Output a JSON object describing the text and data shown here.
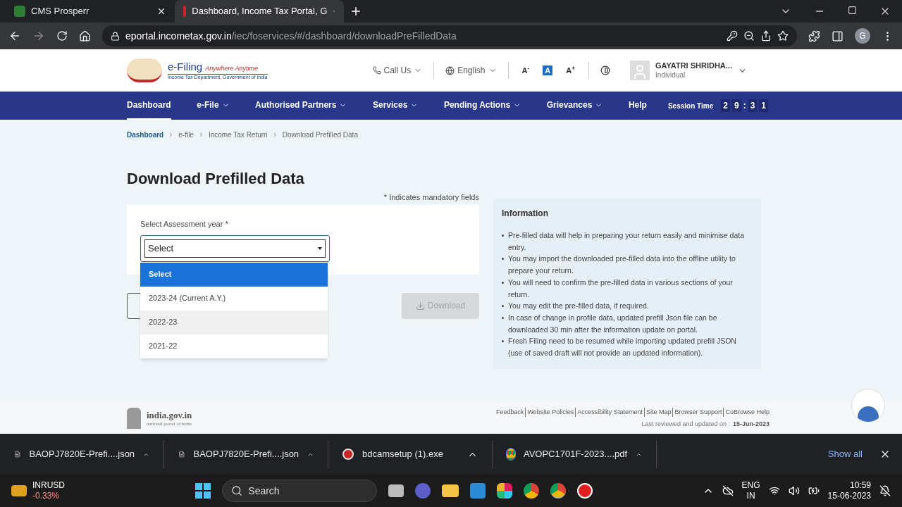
{
  "browser": {
    "tabs": [
      {
        "title": "CMS Prosperr",
        "selected": false
      },
      {
        "title": "Dashboard, Income Tax Portal, G",
        "selected": true
      }
    ],
    "url": {
      "host": "eportal.incometax.gov.in",
      "path": "/iec/foservices/#/dashboard/downloadPreFilledData"
    },
    "profile_initial": "G"
  },
  "header": {
    "logo": {
      "title": "e-Filing",
      "tagline": "Anywhere Anytime",
      "subtitle": "Income Tax Department, Government of India"
    },
    "call_us": "Call Us",
    "language": "English",
    "font_buttons": [
      {
        "label": "A$^{-}$",
        "selected": false
      },
      {
        "label": "A",
        "selected": true
      },
      {
        "label": "A$^{+}$",
        "selected": false
      }
    ],
    "user": {
      "name": "GAYATRI SHRIDHA...",
      "role": "Individual"
    }
  },
  "nav": {
    "items": [
      {
        "label": "Dashboard",
        "selected": true,
        "has_menu": false
      },
      {
        "label": "e-File",
        "selected": false,
        "has_menu": true
      },
      {
        "label": "Authorised Partners",
        "selected": false,
        "has_menu": true
      },
      {
        "label": "Services",
        "selected": false,
        "has_menu": true
      },
      {
        "label": "Pending Actions",
        "selected": false,
        "has_menu": true
      },
      {
        "label": "Grievances",
        "selected": false,
        "has_menu": true
      },
      {
        "label": "Help",
        "selected": false,
        "has_menu": false
      }
    ],
    "session": {
      "label": "Session Time",
      "digits": [
        "2",
        "9",
        ":",
        "3",
        "1"
      ]
    }
  },
  "breadcrumb": [
    {
      "label": "Dashboard",
      "link": true
    },
    {
      "label": "e-file",
      "link": false
    },
    {
      "label": "Income Tax Return",
      "link": false
    },
    {
      "label": "Download Prefilled Data",
      "link": false
    }
  ],
  "form": {
    "title": "Download Prefilled Data",
    "mandatory_note": "* Indicates mandatory fields",
    "field_label": "Select Assessment year *",
    "value": "Select",
    "options": [
      {
        "label": "Select",
        "selected": true,
        "hovered": false
      },
      {
        "label": "2023-24 (Current A.Y.)",
        "selected": false,
        "hovered": false
      },
      {
        "label": "2022-23",
        "selected": false,
        "hovered": true
      },
      {
        "label": "2021-22",
        "selected": false,
        "hovered": false
      }
    ],
    "download": {
      "label": "Download",
      "disabled": true
    }
  },
  "info": {
    "title": "Information",
    "items": [
      "Pre-filled data will help in preparing your return easily and minimise data entry.",
      "You may import the downloaded pre-filled data into the offline utility to prepare your return.",
      "You will need to confirm the pre-filled data in various sections of your return.",
      "You may edit the pre-filled data, if required.",
      "In case of change in profile data, updated prefill Json file can be downloaded 30 min after the information update on portal.",
      "Fresh Filing need to be resumed while importing updated prefill JSON (use of saved draft will not provide an updated information)."
    ]
  },
  "footer": {
    "site": {
      "name": "india.gov.in",
      "tagline": "national portal of india"
    },
    "links": [
      "Feedback",
      "Website Policies",
      "Accessibility Statement",
      "Site Map",
      "Browser Support",
      "CoBrowse Help"
    ],
    "updated_label": "Last reviewed and updated on :",
    "updated_date": "15-Jun-2023"
  },
  "downloads": {
    "items": [
      {
        "name": "BAOPJ7820E-Prefi....json",
        "kind": "file"
      },
      {
        "name": "BAOPJ7820E-Prefi....json",
        "kind": "file"
      },
      {
        "name": "bdcamsetup (1).exe",
        "kind": "app"
      },
      {
        "name": "AVOPC1701F-2023....pdf",
        "kind": "browser"
      }
    ],
    "show_all": "Show all"
  },
  "taskbar": {
    "ticker": {
      "symbol": "INRUSD",
      "change": "-0.33%"
    },
    "search": "Search",
    "lang": [
      "ENG",
      "IN"
    ],
    "time": "10:59",
    "date": "15-06-2023"
  }
}
